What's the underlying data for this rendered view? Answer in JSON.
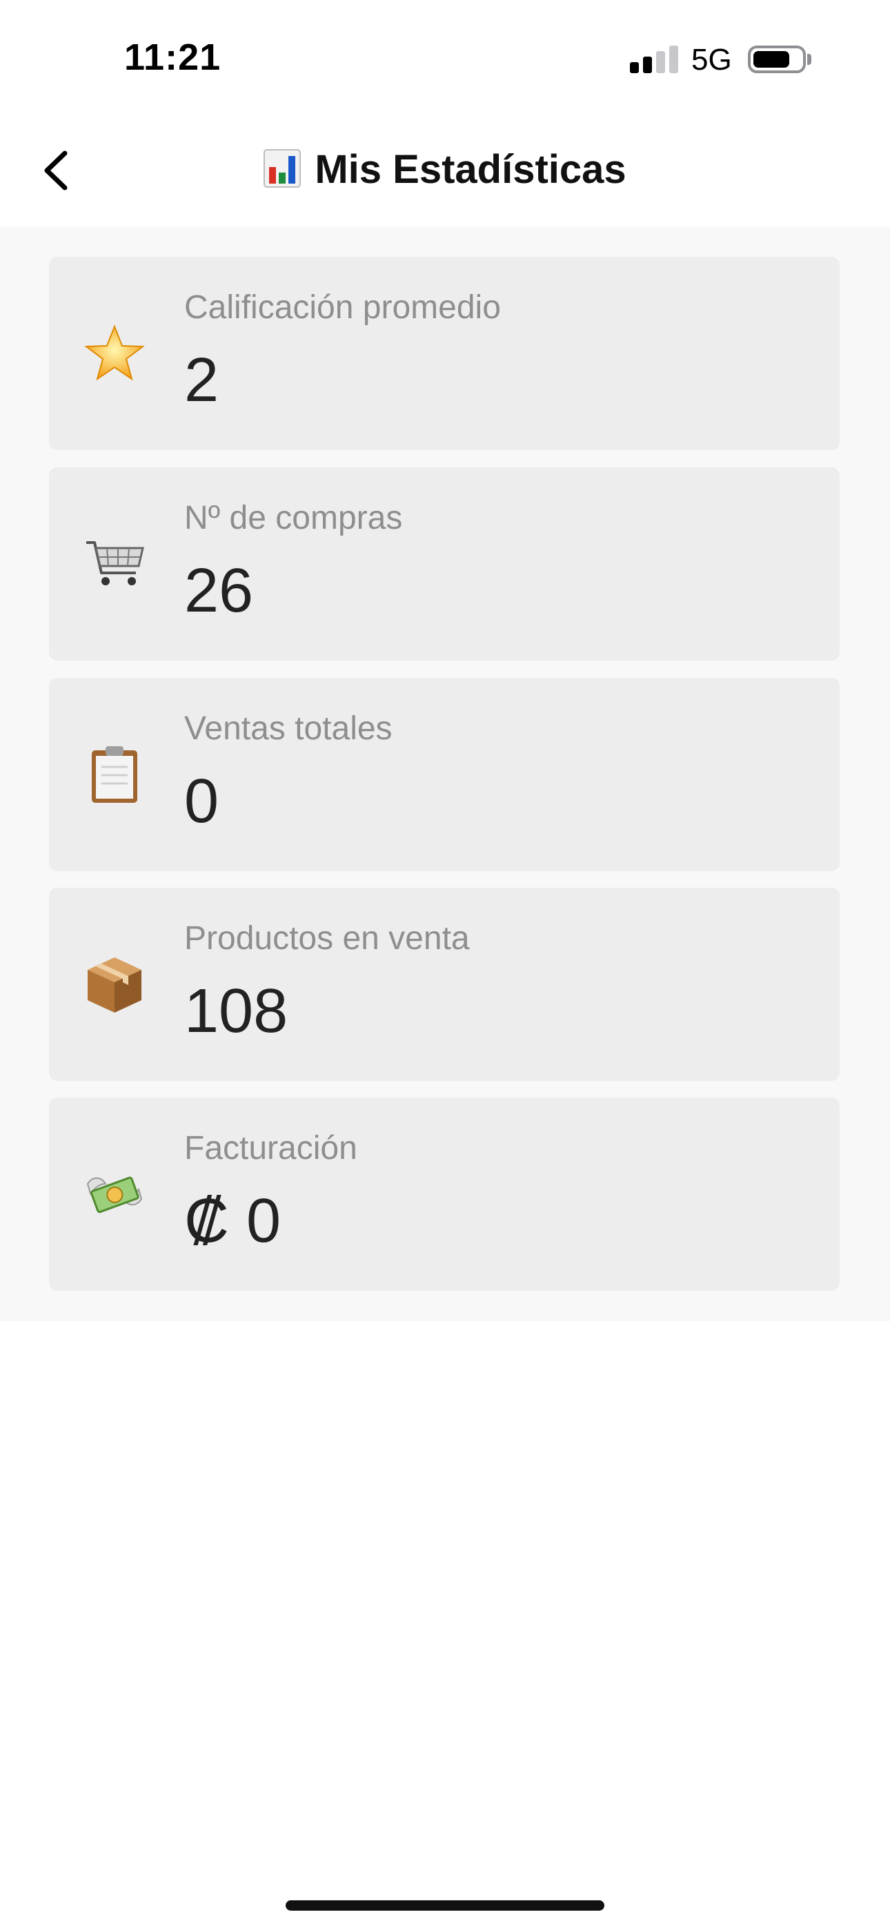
{
  "status_bar": {
    "time": "11:21",
    "network": "5G"
  },
  "nav": {
    "title": "Mis Estadísticas",
    "title_icon": "bar-chart-icon",
    "back_icon": "chevron-left-icon"
  },
  "stats": [
    {
      "icon": "star-icon",
      "label": "Calificación promedio",
      "value": "2"
    },
    {
      "icon": "shopping-cart-icon",
      "label": "Nº de compras",
      "value": "26"
    },
    {
      "icon": "clipboard-icon",
      "label": "Ventas totales",
      "value": "0"
    },
    {
      "icon": "package-icon",
      "label": "Productos en venta",
      "value": "108"
    },
    {
      "icon": "money-with-wings-icon",
      "label": "Facturación",
      "value": "₡ 0"
    }
  ],
  "colors": {
    "card_background": "#ededed",
    "content_background": "#f8f8f8",
    "label_text": "#8e8e8e",
    "value_text": "#222222"
  }
}
